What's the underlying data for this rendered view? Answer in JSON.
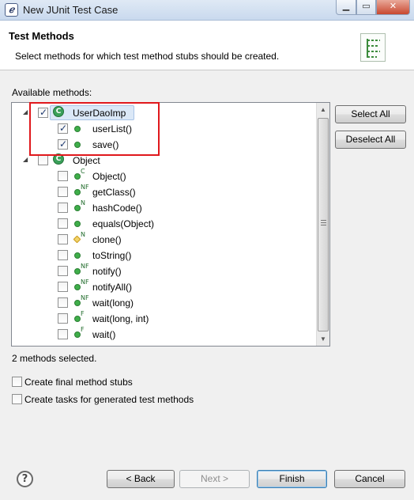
{
  "window": {
    "title": "New JUnit Test Case",
    "minimize_glyph": "▁",
    "maximize_glyph": "▭",
    "close_glyph": "✕"
  },
  "header": {
    "title": "Test Methods",
    "description": "Select methods for which test method stubs should be created."
  },
  "available": {
    "label": "Available methods:",
    "tree": [
      {
        "name": "UserDaoImp",
        "checked": true,
        "expanded": true,
        "selected": true,
        "icon": "class-icon",
        "methods": [
          {
            "name": "userList()",
            "checked": true,
            "icon": "public-method-icon",
            "modifier": ""
          },
          {
            "name": "save()",
            "checked": true,
            "icon": "public-method-icon",
            "modifier": ""
          }
        ]
      },
      {
        "name": "Object",
        "checked": false,
        "expanded": true,
        "selected": false,
        "icon": "class-icon",
        "methods": [
          {
            "name": "Object()",
            "checked": false,
            "icon": "public-method-icon",
            "modifier": "C"
          },
          {
            "name": "getClass()",
            "checked": false,
            "icon": "public-method-icon",
            "modifier": "NF"
          },
          {
            "name": "hashCode()",
            "checked": false,
            "icon": "public-method-icon",
            "modifier": "N"
          },
          {
            "name": "equals(Object)",
            "checked": false,
            "icon": "public-method-icon",
            "modifier": ""
          },
          {
            "name": "clone()",
            "checked": false,
            "icon": "protected-method-icon",
            "modifier": "N"
          },
          {
            "name": "toString()",
            "checked": false,
            "icon": "public-method-icon",
            "modifier": ""
          },
          {
            "name": "notify()",
            "checked": false,
            "icon": "public-method-icon",
            "modifier": "NF"
          },
          {
            "name": "notifyAll()",
            "checked": false,
            "icon": "public-method-icon",
            "modifier": "NF"
          },
          {
            "name": "wait(long)",
            "checked": false,
            "icon": "public-method-icon",
            "modifier": "NF"
          },
          {
            "name": "wait(long, int)",
            "checked": false,
            "icon": "public-method-icon",
            "modifier": "F"
          },
          {
            "name": "wait()",
            "checked": false,
            "icon": "public-method-icon",
            "modifier": "F"
          }
        ]
      }
    ],
    "class_icon_glyph": "C",
    "expand_glyph": "◢",
    "scroll_up_glyph": "▲",
    "scroll_down_glyph": "▼"
  },
  "side_buttons": {
    "select_all": "Select All",
    "deselect_all": "Deselect All"
  },
  "status": "2 methods selected.",
  "options": [
    {
      "label": "Create final method stubs",
      "checked": false
    },
    {
      "label": "Create tasks for generated test methods",
      "checked": false
    }
  ],
  "footer": {
    "help_glyph": "?",
    "back": "< Back",
    "next": "Next >",
    "finish": "Finish",
    "cancel": "Cancel"
  },
  "colors": {
    "highlight_border": "#e0181c",
    "selection_bg": "#dbe8f7",
    "method_public": "#3fae4a",
    "class_icon": "#3aa05a"
  }
}
